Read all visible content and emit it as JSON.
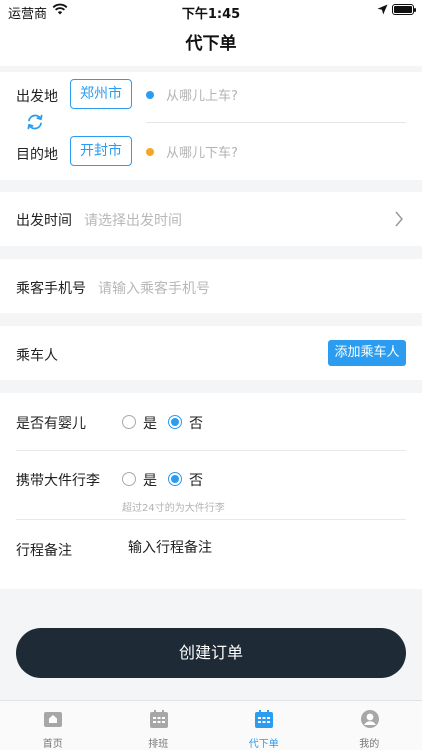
{
  "status_bar": {
    "carrier": "运营商",
    "time": "下午1:45"
  },
  "nav": {
    "title": "代下单"
  },
  "route": {
    "departure_label": "出发地",
    "departure_city": "郑州市",
    "pickup_placeholder": "从哪儿上车?",
    "destination_label": "目的地",
    "destination_city": "开封市",
    "dropoff_placeholder": "从哪儿下车?"
  },
  "departure_time": {
    "label": "出发时间",
    "placeholder": "请选择出发时间"
  },
  "phone": {
    "label": "乘客手机号",
    "placeholder": "请输入乘客手机号"
  },
  "passenger": {
    "label": "乘车人",
    "add_button": "添加乘车人"
  },
  "infant": {
    "label": "是否有婴儿",
    "yes": "是",
    "no": "否",
    "selected": "no"
  },
  "luggage": {
    "label": "携带大件行李",
    "yes": "是",
    "no": "否",
    "selected": "no",
    "hint": "超过24寸的为大件行李"
  },
  "remark": {
    "label": "行程备注",
    "value": "输入行程备注"
  },
  "submit": {
    "label": "创建订单"
  },
  "tabs": [
    {
      "label": "首页",
      "icon": "home-icon"
    },
    {
      "label": "排班",
      "icon": "schedule-icon"
    },
    {
      "label": "代下单",
      "icon": "calendar-icon",
      "active": true
    },
    {
      "label": "我的",
      "icon": "user-icon"
    }
  ],
  "colors": {
    "accent": "#2b9cf0",
    "pickup_dot": "#2b9cf0",
    "dropoff_dot": "#f5a623",
    "submit_bg": "#1e2b37"
  }
}
